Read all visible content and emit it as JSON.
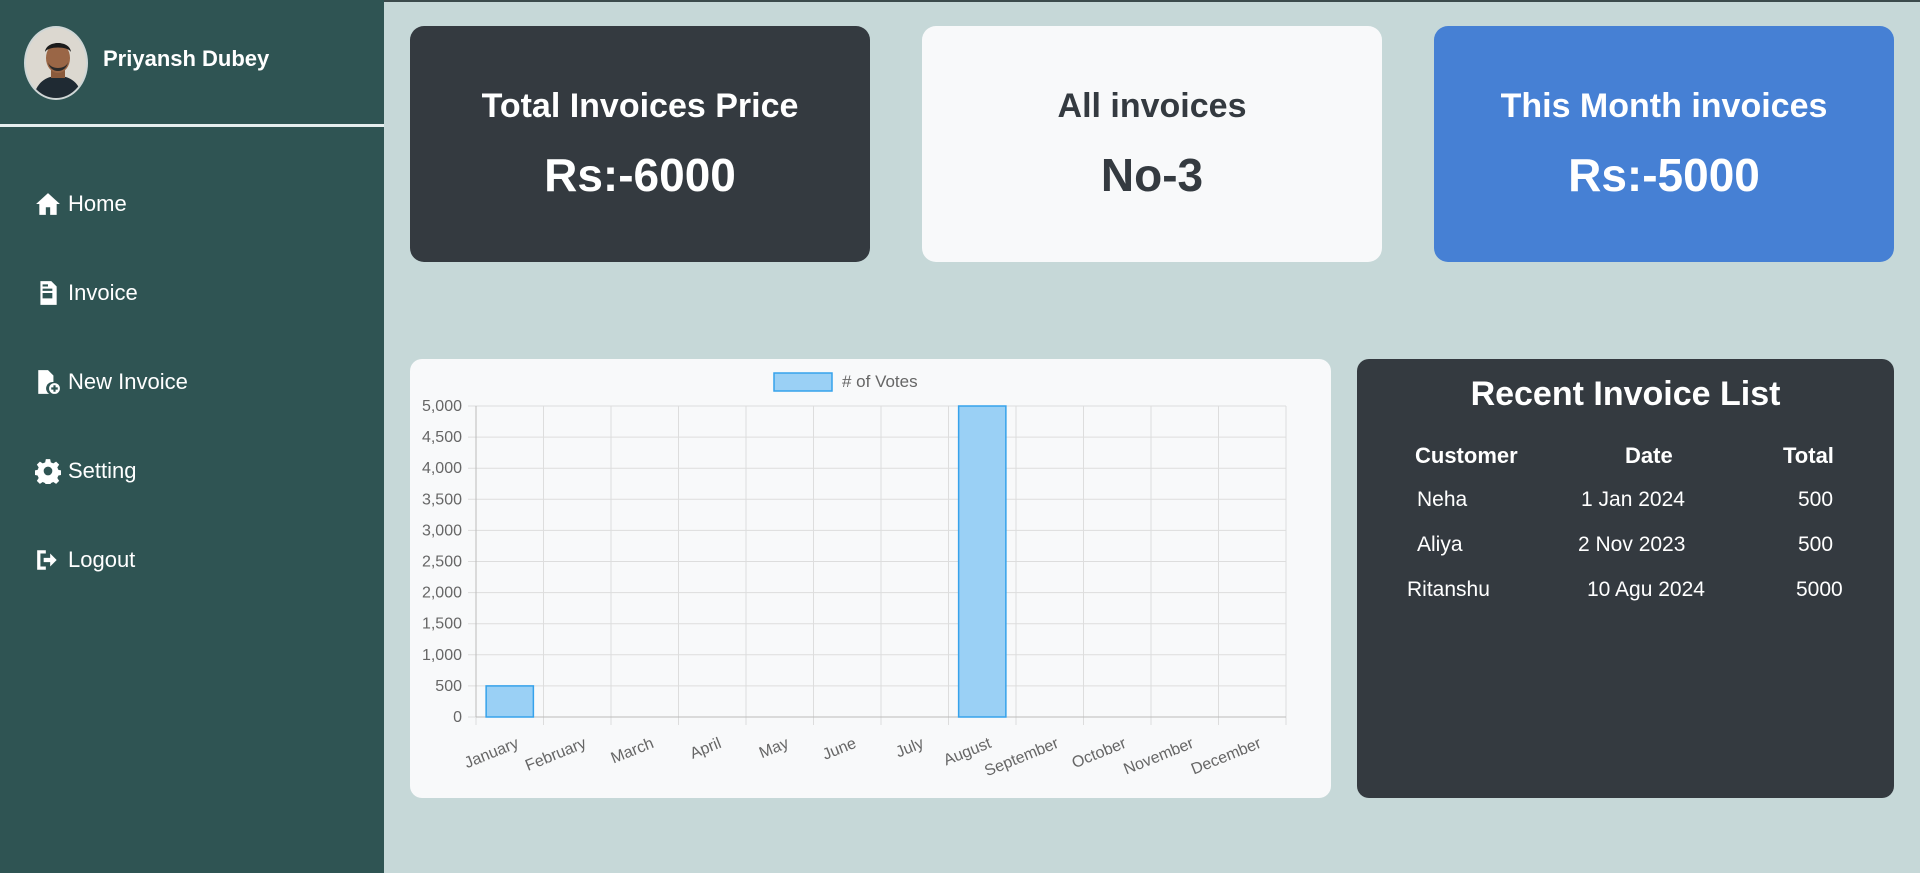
{
  "profile": {
    "name": "Priyansh Dubey"
  },
  "sidebar": {
    "items": [
      {
        "label": "Home",
        "icon": "home-icon"
      },
      {
        "label": "Invoice",
        "icon": "invoice-icon"
      },
      {
        "label": "New Invoice",
        "icon": "new-invoice-icon"
      },
      {
        "label": "Setting",
        "icon": "gear-icon"
      },
      {
        "label": "Logout",
        "icon": "logout-icon"
      }
    ]
  },
  "cards": [
    {
      "title": "Total Invoices Price",
      "value": "Rs:-6000"
    },
    {
      "title": "All invoices",
      "value": "No-3"
    },
    {
      "title": "This Month invoices",
      "value": "Rs:-5000"
    }
  ],
  "colors": {
    "sidebar": "#2f5453",
    "background": "#c6d8d8",
    "dark_card": "#343a40",
    "light_card": "#f8f9fa",
    "blue_card": "#4680d4",
    "bar_fill": "#9ad0f5",
    "bar_border": "#36a2eb"
  },
  "chart_data": {
    "type": "bar",
    "legend": "# of Votes",
    "legend_position": "top",
    "grid": true,
    "categories": [
      "January",
      "February",
      "March",
      "April",
      "May",
      "June",
      "July",
      "August",
      "September",
      "October",
      "November",
      "December"
    ],
    "values": [
      500,
      0,
      0,
      0,
      0,
      0,
      0,
      5000,
      0,
      0,
      0,
      0
    ],
    "yticks": [
      "5,000",
      "4,500",
      "4,000",
      "3,500",
      "3,000",
      "2,500",
      "2,000",
      "1,500",
      "1,000",
      "500",
      "0"
    ],
    "ylim": [
      0,
      5000
    ]
  },
  "recent": {
    "title": "Recent Invoice List",
    "headers": [
      "Customer",
      "Date",
      "Total"
    ],
    "rows": [
      {
        "customer": "Neha",
        "date": "1 Jan 2024",
        "total": "500"
      },
      {
        "customer": "Aliya",
        "date": "2 Nov 2023",
        "total": "500"
      },
      {
        "customer": "Ritanshu",
        "date": "10 Agu 2024",
        "total": "5000"
      }
    ]
  }
}
